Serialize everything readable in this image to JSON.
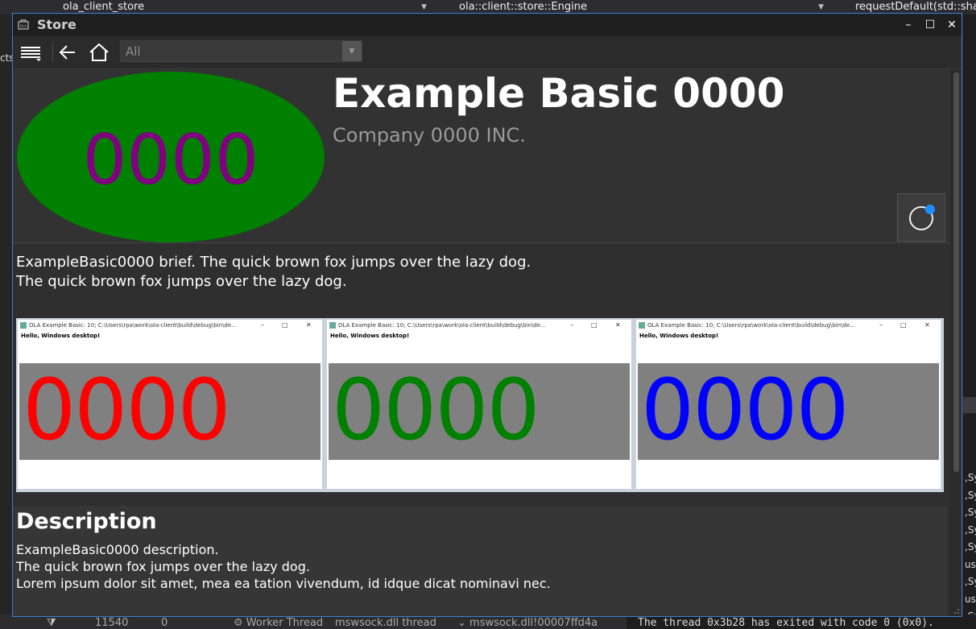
{
  "ide": {
    "top_project": "ola_client_store",
    "top_scope": "ola::client::store::Engine",
    "top_member": "requestDefault(std::sha",
    "left_text": "cts",
    "right_lines": [
      ",Sy",
      ",Sy",
      ",Sy",
      ",Sy",
      ",Sy",
      "us\\",
      ",Sy",
      "us\\",
      ",Sy"
    ],
    "bottom_id": "11540",
    "bottom_zero": "0",
    "bottom_thread": "Worker Thread",
    "bottom_module": "mswsock.dll thread",
    "bottom_frame": "mswsock.dll!00007ffd4a",
    "bottom_output": "The thread 0x3b28 has exited with code 0 (0x0)."
  },
  "window": {
    "title": "Store",
    "minimize": "–",
    "maximize": "☐",
    "close": "✕"
  },
  "toolbar": {
    "filter_value": "All"
  },
  "app": {
    "logo_text": "0000",
    "logo_bg": "#008000",
    "logo_fg": "#800080",
    "title": "Example Basic 0000",
    "company": "Company 0000 INC.",
    "brief_line1": "ExampleBasic0000 brief. The quick brown fox jumps over the lazy dog.",
    "brief_line2": "The quick brown fox jumps over the lazy dog."
  },
  "screenshots": [
    {
      "title": "OLA Example Basic: 10; C:\\Users\\rpa\\work\\ola-client\\build\\debug\\bin\\de...",
      "hello": "Hello, Windows desktop!",
      "digits": "0000",
      "color": "#ff0000"
    },
    {
      "title": "OLA Example Basic: 10; C:\\Users\\rpa\\work\\ola-client\\build\\debug\\bin\\de...",
      "hello": "Hello, Windows desktop!",
      "digits": "0000",
      "color": "#008000"
    },
    {
      "title": "OLA Example Basic: 10; C:\\Users\\rpa\\work\\ola-client\\build\\debug\\bin\\de...",
      "hello": "Hello, Windows desktop!",
      "digits": "0000",
      "color": "#0000ff"
    }
  ],
  "description": {
    "heading": "Description",
    "body": "ExampleBasic0000 description.\nThe quick brown fox jumps over the lazy dog.\nLorem ipsum dolor sit amet, mea ea tation vivendum, id idque dicat nominavi nec."
  },
  "colors": {
    "accent": "#1e90ff",
    "window_border": "#3d7fd6"
  }
}
